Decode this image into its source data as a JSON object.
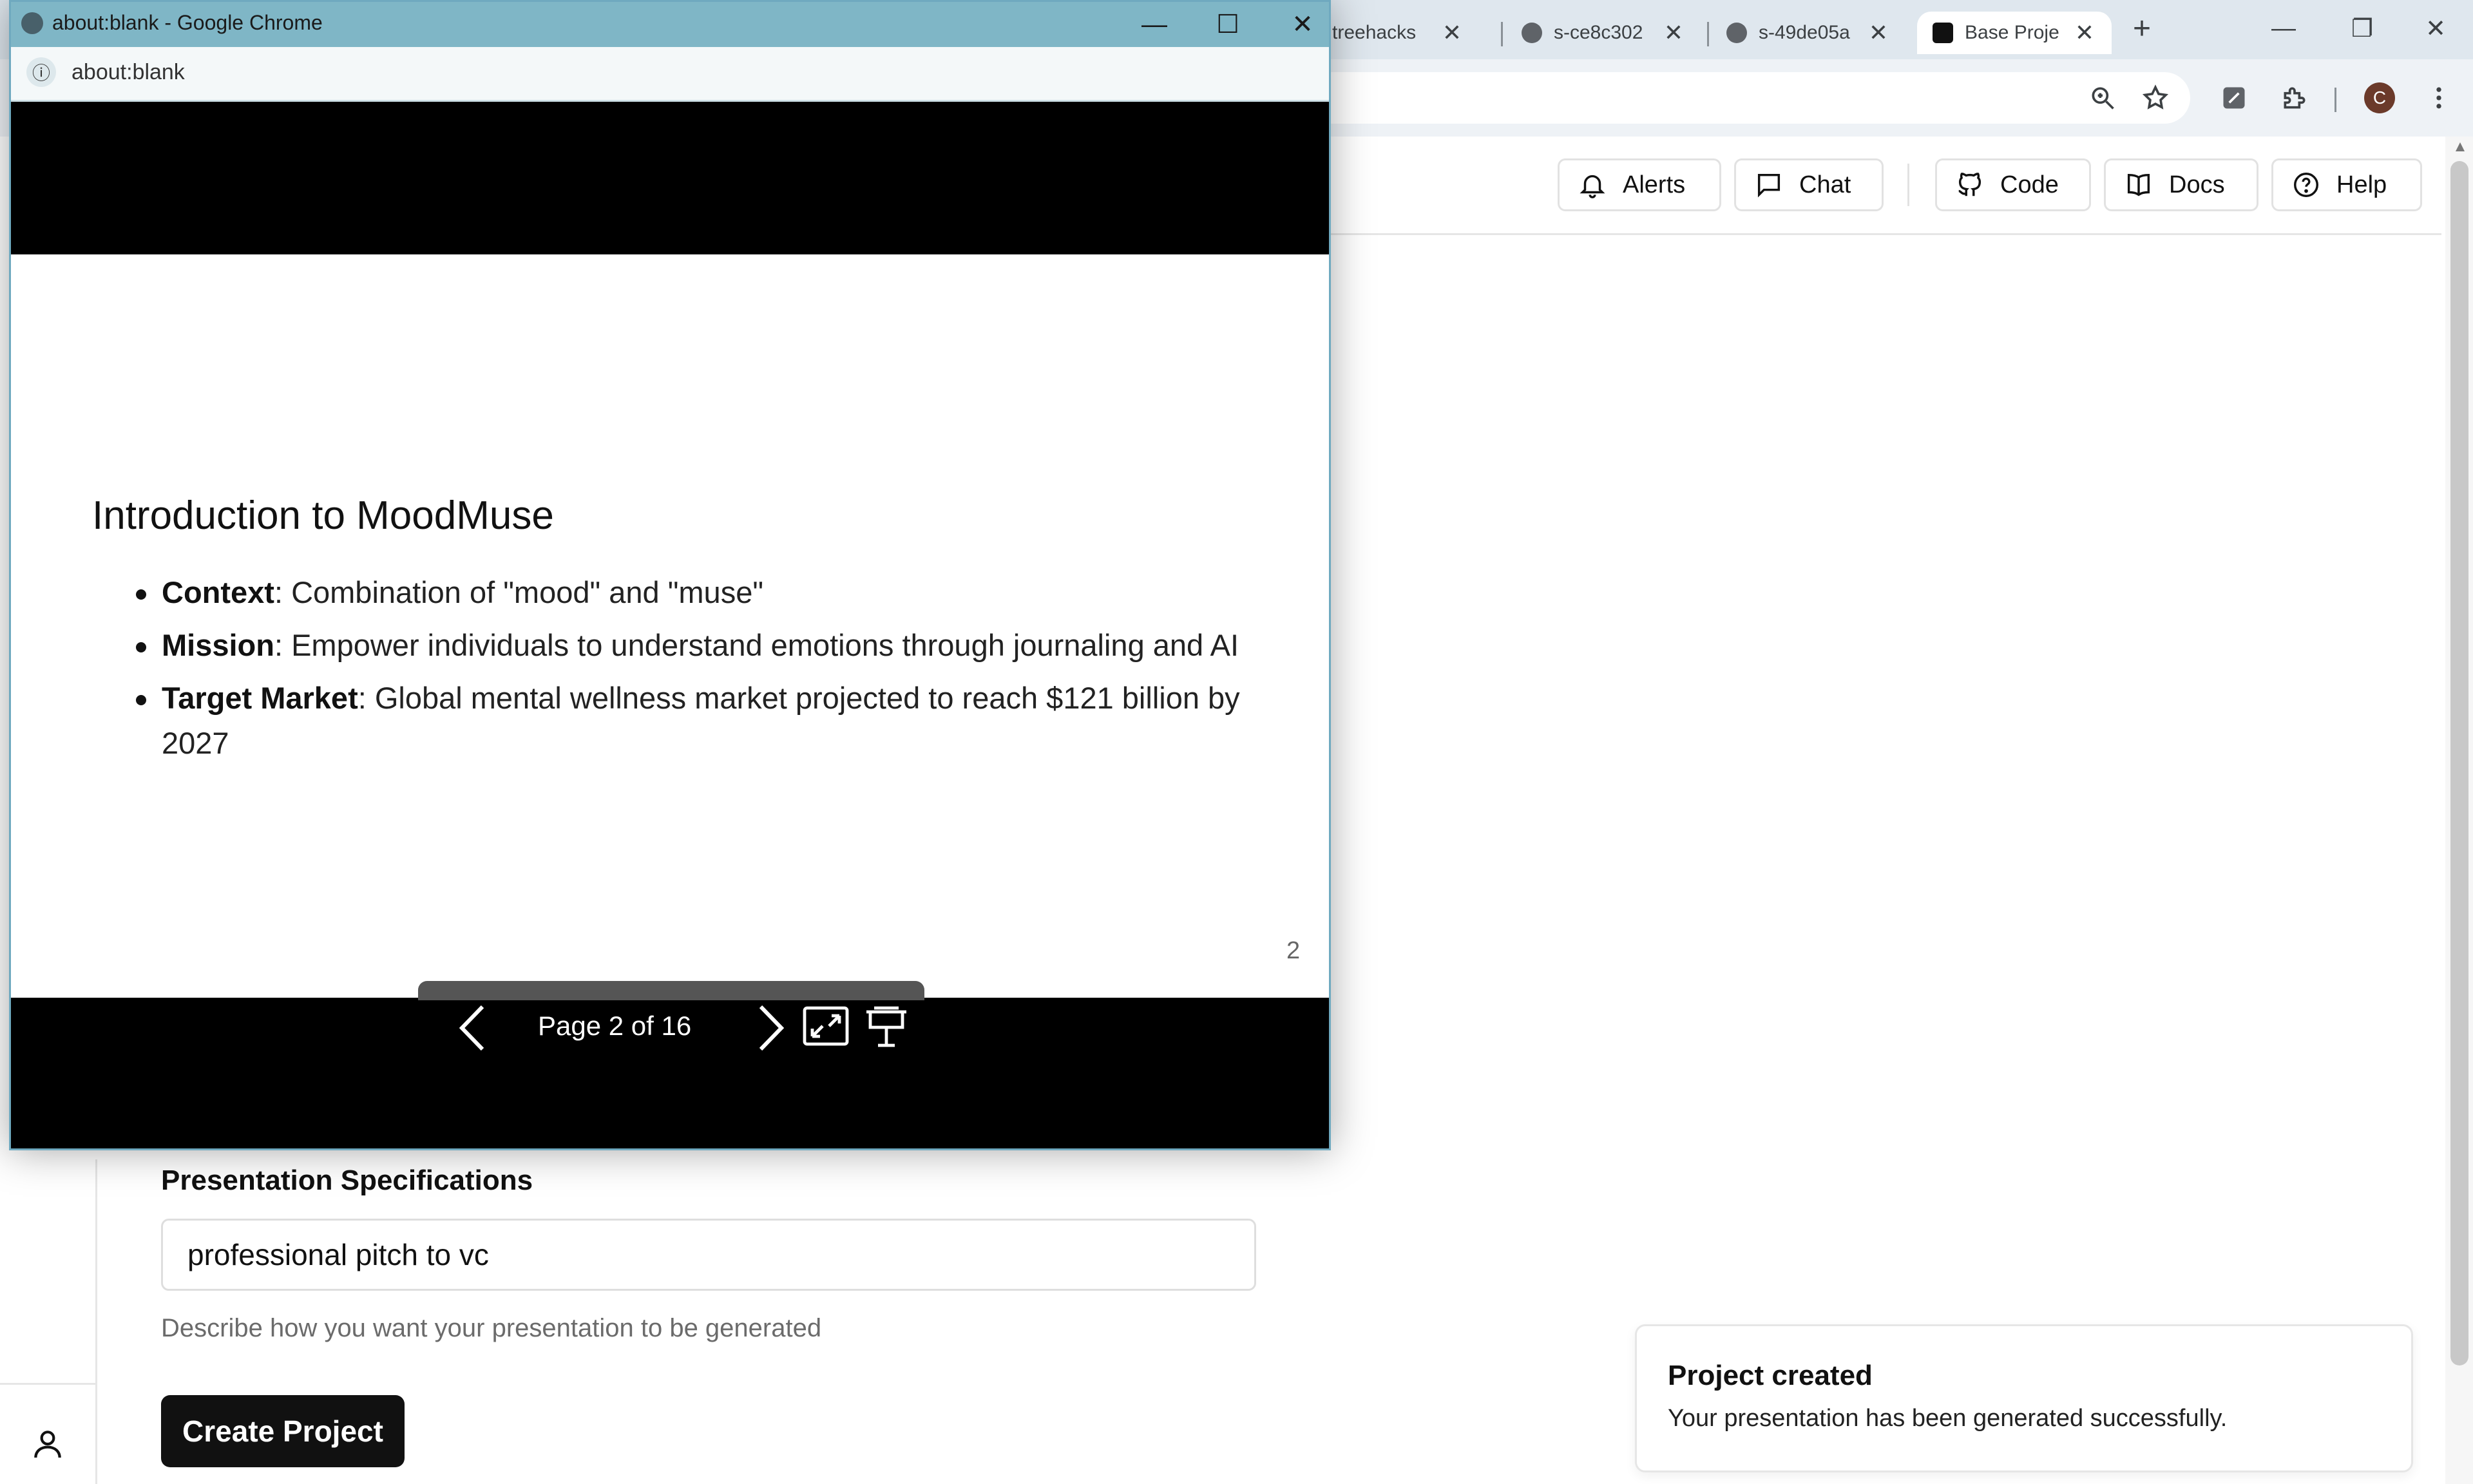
{
  "browser": {
    "tabs": [
      {
        "title": "treehacks",
        "close": "✕"
      },
      {
        "title": "s-ce8c302",
        "close": "✕"
      },
      {
        "title": "s-49de05a",
        "close": "✕"
      },
      {
        "title": "Base Proje",
        "close": "✕",
        "active": true
      }
    ],
    "new_tab": "+",
    "window_controls": {
      "minimize": "—",
      "restore": "❐",
      "close": "✕"
    },
    "profile_initial": "C"
  },
  "header": {
    "buttons": [
      {
        "label": "Alerts",
        "icon": "bell-icon"
      },
      {
        "label": "Chat",
        "icon": "chat-icon"
      },
      {
        "label": "Code",
        "icon": "github-icon"
      },
      {
        "label": "Docs",
        "icon": "book-icon"
      },
      {
        "label": "Help",
        "icon": "help-icon"
      }
    ]
  },
  "form": {
    "spec_label": "Presentation Specifications",
    "spec_value": "professional pitch to vc",
    "spec_help": "Describe how you want your presentation to be generated",
    "create_label": "Create Project"
  },
  "toast": {
    "title": "Project created",
    "description": "Your presentation has been generated successfully."
  },
  "popup": {
    "window_title": "about:blank - Google Chrome",
    "url": "about:blank",
    "controls": {
      "minimize": "—",
      "maximize": "☐",
      "close": "✕"
    },
    "slide": {
      "title": "Introduction to MoodMuse",
      "bullets": [
        {
          "term": "Context",
          "text": ": Combination of \"mood\" and \"muse\""
        },
        {
          "term": "Mission",
          "text": ": Empower individuals to understand emotions through journaling and AI"
        },
        {
          "term": "Target Market",
          "text": ": Global mental wellness market projected to reach $121 billion by 2027"
        }
      ],
      "page_number": "2"
    },
    "pager": {
      "text": "Page 2 of 16"
    }
  }
}
